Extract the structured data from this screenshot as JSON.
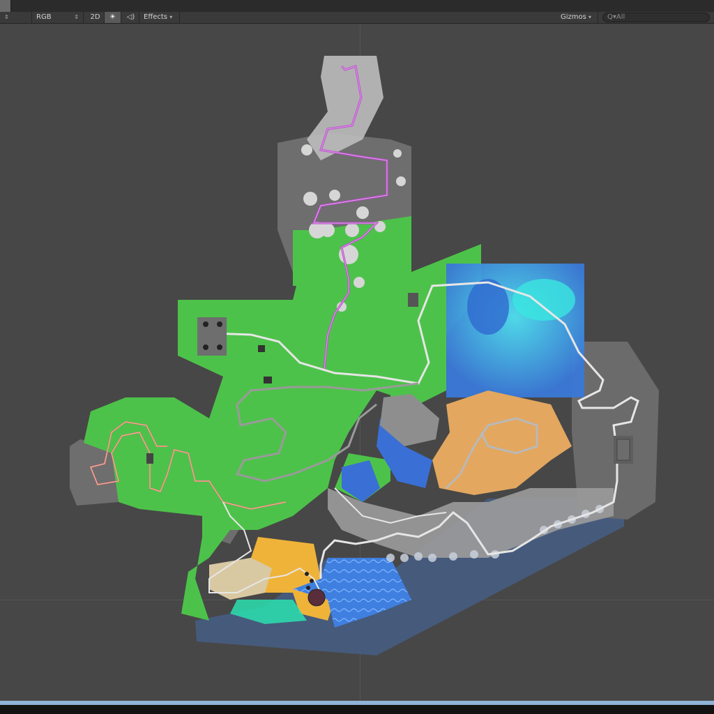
{
  "toolbar": {
    "mode_arrows": "⇕",
    "channel": "RGB",
    "channel_arrows": "⇕",
    "two_d": "2D",
    "light_icon": "☀",
    "audio_icon": "◁)",
    "effects": "Effects",
    "effects_arrow": "▾",
    "gizmos": "Gizmos",
    "gizmos_arrow": "▾",
    "search_placeholder": "Q▾All"
  },
  "colors": {
    "background": "#474747",
    "terrain_grass": "#4dc24a",
    "terrain_rock": "#6c6c6c",
    "sand": "#e3a75f",
    "water": "#3c6fd6",
    "sea": "#475c7f",
    "track_white": "#e6e6e6",
    "track_magenta": "#c04ad2"
  },
  "icons": [
    "updown-arrows-icon",
    "sun-icon",
    "speaker-icon",
    "dropdown-arrow-icon",
    "search-icon"
  ]
}
